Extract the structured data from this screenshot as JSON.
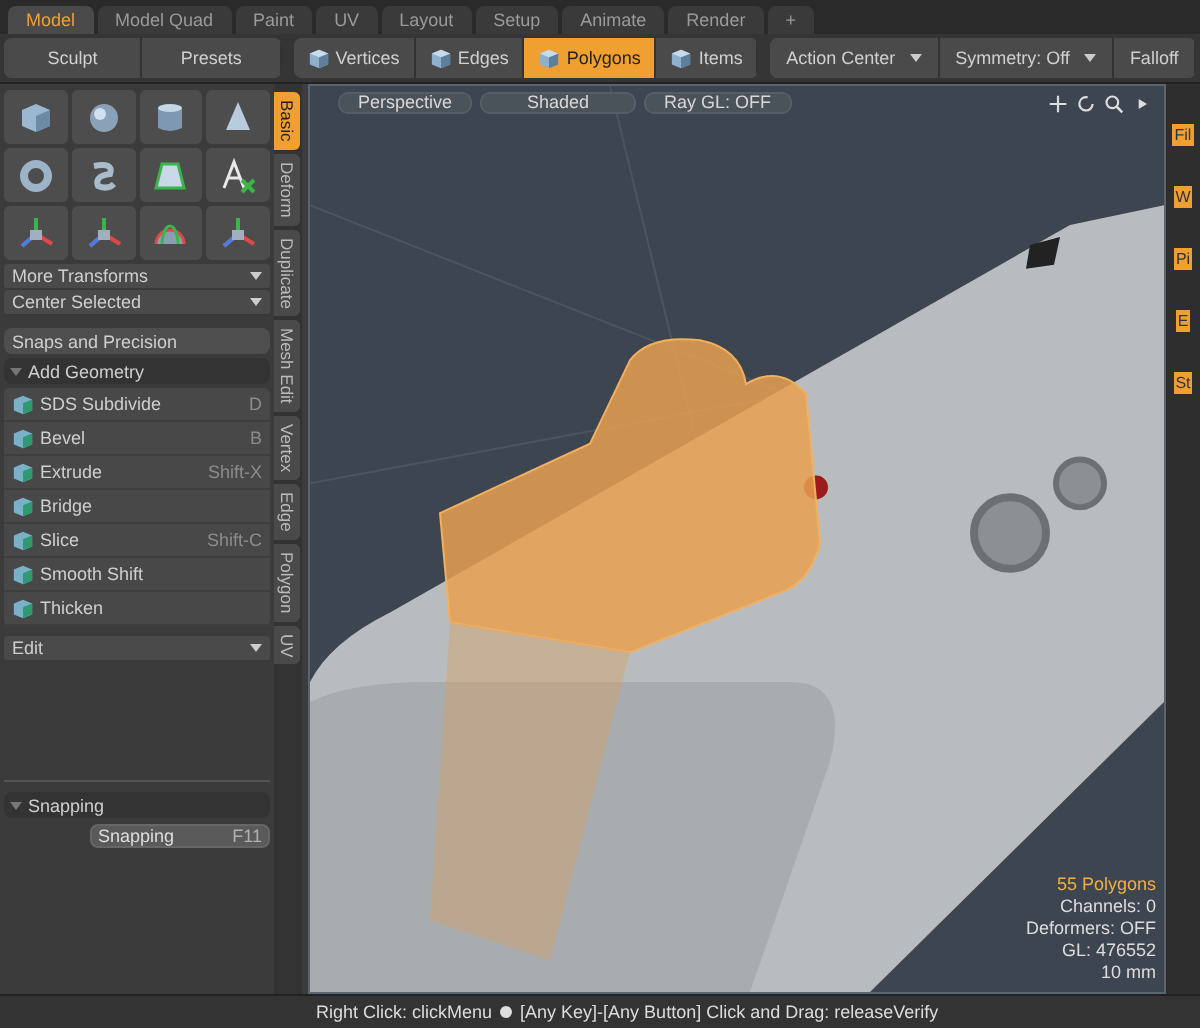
{
  "tabs": [
    {
      "label": "Model",
      "selected": true
    },
    {
      "label": "Model Quad",
      "selected": false
    },
    {
      "label": "Paint",
      "selected": false
    },
    {
      "label": "UV",
      "selected": false
    },
    {
      "label": "Layout",
      "selected": false
    },
    {
      "label": "Setup",
      "selected": false
    },
    {
      "label": "Animate",
      "selected": false
    },
    {
      "label": "Render",
      "selected": false
    },
    {
      "label": "+",
      "selected": false
    }
  ],
  "toolbar": {
    "left_buttons": [
      "Sculpt",
      "Presets"
    ],
    "modes": [
      {
        "label": "Vertices",
        "selected": false
      },
      {
        "label": "Edges",
        "selected": false
      },
      {
        "label": "Polygons",
        "selected": true
      },
      {
        "label": "Items",
        "selected": false
      }
    ],
    "right_buttons": [
      {
        "label": "Action Center",
        "dropdown": true
      },
      {
        "label": "Symmetry: Off",
        "dropdown": true
      },
      {
        "label": "Falloff",
        "dropdown": false
      }
    ]
  },
  "tool_palette": {
    "dropdowns": [
      "More Transforms",
      "Center Selected"
    ],
    "snaps_button": "Snaps and Precision",
    "section": {
      "title": "Add Geometry",
      "expanded": true
    },
    "tools": [
      {
        "name": "SDS Subdivide",
        "shortcut": "D"
      },
      {
        "name": "Bevel",
        "shortcut": "B"
      },
      {
        "name": "Extrude",
        "shortcut": "Shift-X"
      },
      {
        "name": "Bridge"
      },
      {
        "name": "Slice",
        "shortcut": "Shift-C"
      },
      {
        "name": "Smooth Shift"
      },
      {
        "name": "Thicken"
      }
    ],
    "bottom_dropdown": "Edit"
  },
  "vertical_tabs": [
    {
      "label": "Basic",
      "selected": true
    },
    {
      "label": "Deform",
      "selected": false
    },
    {
      "label": "Duplicate",
      "selected": false
    },
    {
      "label": "Mesh Edit",
      "selected": false
    },
    {
      "label": "Vertex",
      "selected": false
    },
    {
      "label": "Edge",
      "selected": false
    },
    {
      "label": "Polygon",
      "selected": false
    },
    {
      "label": "UV",
      "selected": false
    }
  ],
  "snapping_panel": {
    "title": "Snapping",
    "expanded": true,
    "button": {
      "label": "Snapping",
      "shortcut": "F11"
    }
  },
  "viewport": {
    "buttons": [
      "Perspective",
      "Shaded",
      "Ray GL: OFF"
    ],
    "info": [
      {
        "text": "55 Polygons",
        "highlight": true
      },
      {
        "text": "Channels: 0",
        "highlight": false
      },
      {
        "text": "Deformers: OFF",
        "highlight": false
      },
      {
        "text": "GL: 476552",
        "highlight": false
      },
      {
        "text": "10 mm",
        "highlight": false
      }
    ]
  },
  "right_panel": {
    "labels": [
      "Fil",
      "W",
      "Pi",
      "E",
      "St"
    ]
  },
  "status_bar": {
    "left": "Right Click: clickMenu",
    "right": "[Any Key]-[Any Button] Click and Drag: releaseVerify"
  }
}
